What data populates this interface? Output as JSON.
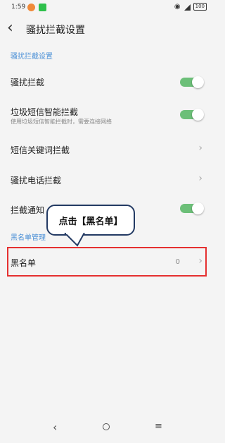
{
  "status_bar": {
    "time": "1:59",
    "battery": "100"
  },
  "header": {
    "title": "骚扰拦截设置"
  },
  "section_settings": {
    "label": "骚扰拦截设置"
  },
  "rows": {
    "harass_block": {
      "label": "骚扰拦截",
      "enabled": true
    },
    "spam_sms": {
      "label": "垃圾短信智能拦截",
      "sub": "使用垃圾短信智能拦截时，需要连接网络",
      "enabled": true
    },
    "keyword_block": {
      "label": "短信关键词拦截"
    },
    "call_block": {
      "label": "骚扰电话拦截"
    },
    "notify": {
      "label": "拦截通知",
      "enabled": true
    }
  },
  "section_blacklist": {
    "label": "黑名单管理"
  },
  "blacklist": {
    "label": "黑名单",
    "count": "0"
  },
  "annotation": {
    "text": "点击【黑名单】"
  },
  "colors": {
    "accent": "#6cbf78",
    "section": "#4a8fd6",
    "highlight": "#e53030",
    "callout_border": "#233a63"
  }
}
